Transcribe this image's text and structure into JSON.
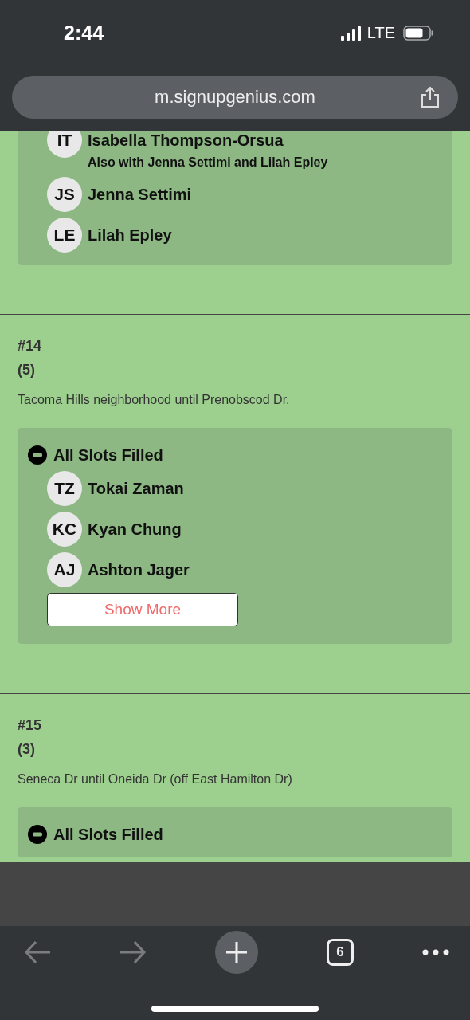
{
  "status_bar": {
    "time": "2:44",
    "network": "LTE"
  },
  "address_bar": {
    "url": "m.signupgenius.com"
  },
  "sections": [
    {
      "slots": {
        "signups": [
          {
            "initials": "IT",
            "name": "Isabella Thompson-Orsua",
            "note": "Also with Jenna Settimi and Lilah Epley"
          },
          {
            "initials": "JS",
            "name": "Jenna Settimi"
          },
          {
            "initials": "LE",
            "name": "Lilah Epley"
          }
        ]
      }
    },
    {
      "number": "#14",
      "count": "(5)",
      "description": "Tacoma Hills neighborhood until Prenobscod Dr.",
      "slots": {
        "status": "All Slots Filled",
        "signups": [
          {
            "initials": "TZ",
            "name": "Tokai Zaman"
          },
          {
            "initials": "KC",
            "name": "Kyan Chung"
          },
          {
            "initials": "AJ",
            "name": "Ashton Jager"
          }
        ],
        "show_more": "Show More"
      }
    },
    {
      "number": "#15",
      "count": "(3)",
      "description": "Seneca Dr until Oneida Dr (off East Hamilton Dr)",
      "slots": {
        "status": "All Slots Filled"
      }
    }
  ],
  "toolbar": {
    "back": {
      "disabled": true
    },
    "forward": {
      "disabled": true
    },
    "tab_count": "6"
  }
}
